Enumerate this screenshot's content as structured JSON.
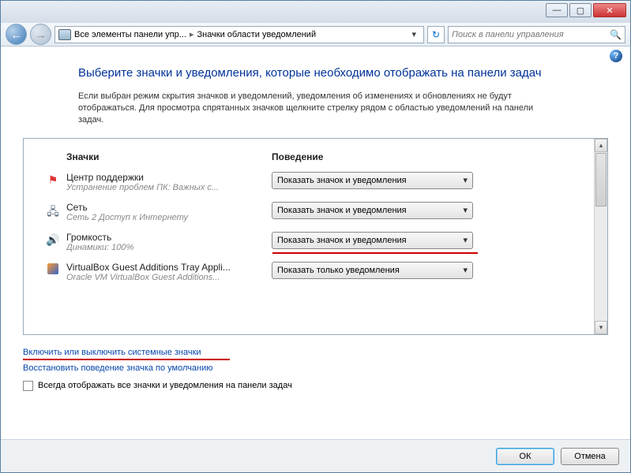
{
  "titlebar": {
    "min": "—",
    "max": "▢",
    "close": "✕"
  },
  "nav": {
    "back": "←",
    "fwd": "→",
    "refresh": "↻",
    "searchIcon": "🔍"
  },
  "breadcrumb": {
    "root": "Все элементы панели упр...",
    "current": "Значки области уведомлений",
    "sep": "▸"
  },
  "search": {
    "placeholder": "Поиск в панели управления"
  },
  "help": {
    "icon": "?"
  },
  "heading": "Выберите значки и уведомления, которые необходимо отображать на панели задач",
  "description": "Если выбран режим скрытия значков и уведомлений, уведомления об изменениях и обновлениях не будут отображаться. Для просмотра спрятанных значков щелкните стрелку рядом с областью уведомлений на панели задач.",
  "columns": {
    "col1": "Значки",
    "col2": "Поведение"
  },
  "options": {
    "showAll": "Показать значок и уведомления",
    "showNotif": "Показать только уведомления"
  },
  "rows": [
    {
      "title": "Центр поддержки",
      "sub": "Устранение проблем ПК: Важных с...",
      "opt": "showAll",
      "icon": "flag"
    },
    {
      "title": "Сеть",
      "sub": "Сеть  2 Доступ к Интернету",
      "opt": "showAll",
      "icon": "net"
    },
    {
      "title": "Громкость",
      "sub": "Динамики: 100%",
      "opt": "showAll",
      "icon": "vol"
    },
    {
      "title": "VirtualBox Guest Additions Tray Appli...",
      "sub": "Oracle VM VirtualBox Guest Additions...",
      "opt": "showNotif",
      "icon": "vb"
    }
  ],
  "links": {
    "toggleSystem": "Включить или выключить системные значки",
    "restore": "Восстановить поведение значка по умолчанию"
  },
  "checkbox": {
    "label": "Всегда отображать все значки и уведомления на панели задач"
  },
  "buttons": {
    "ok": "ОК",
    "cancel": "Отмена"
  },
  "scroll": {
    "up": "▴",
    "down": "▾"
  }
}
